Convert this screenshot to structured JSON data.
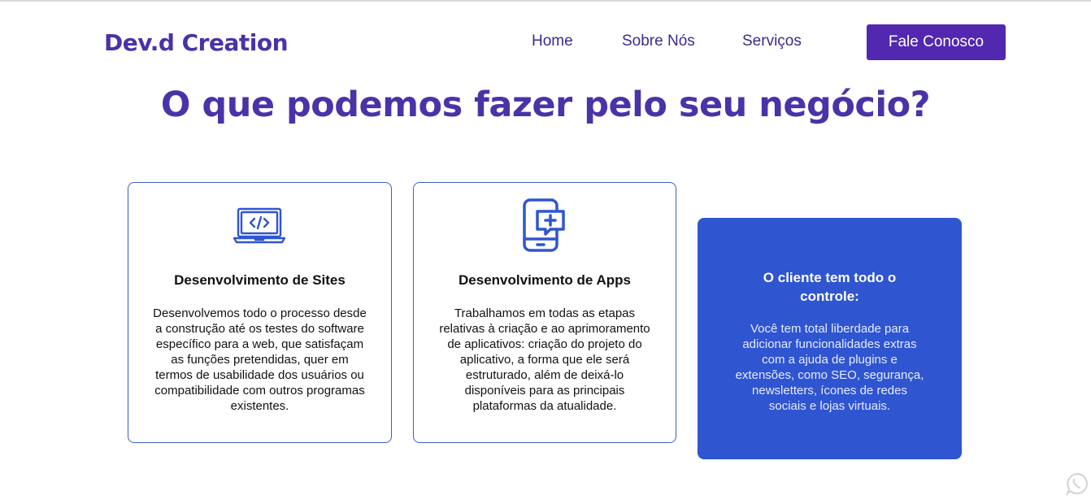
{
  "header": {
    "logo": "Dev.d Creation",
    "nav": [
      "Home",
      "Sobre Nós",
      "Serviços"
    ],
    "cta": "Fale Conosco"
  },
  "hero": {
    "title": "O que podemos fazer pelo seu negócio?"
  },
  "cards": [
    {
      "icon": "laptop-code-icon",
      "title": "Desenvolvimento de Sites",
      "lines": [
        "Desenvolvemos todo o processo desde",
        "a construção até os testes do software",
        "específico para a web, que satisfaçam",
        "as funções pretendidas, quer em",
        "termos de usabilidade dos usuários ou",
        "compatibilidade com outros programas",
        "existentes."
      ]
    },
    {
      "icon": "mobile-chat-icon",
      "title": "Desenvolvimento de Apps",
      "lines": [
        "Trabalhamos em todas as etapas",
        "relativas à criação e ao aprimoramento",
        "de aplicativos: criação do projeto do",
        "aplicativo, a forma que ele será",
        "estruturado, além de deixá-lo",
        "disponíveis para as principais",
        "plataformas da atualidade."
      ]
    },
    {
      "title_lines": [
        "O cliente tem todo o",
        "controle:"
      ],
      "lines": [
        "Você tem total liberdade para",
        "adicionar funcionalidades extras",
        "com a ajuda de plugins e",
        "extensões, como SEO, segurança,",
        "newsletters, ícones de redes",
        "sociais e lojas virtuais."
      ]
    }
  ],
  "colors": {
    "brand_purple": "#4a32a8",
    "cta_purple": "#5228b0",
    "card_blue": "#2f55d0",
    "icon_blue": "#2f55d0"
  },
  "floating": {
    "icon": "whatsapp-icon"
  }
}
